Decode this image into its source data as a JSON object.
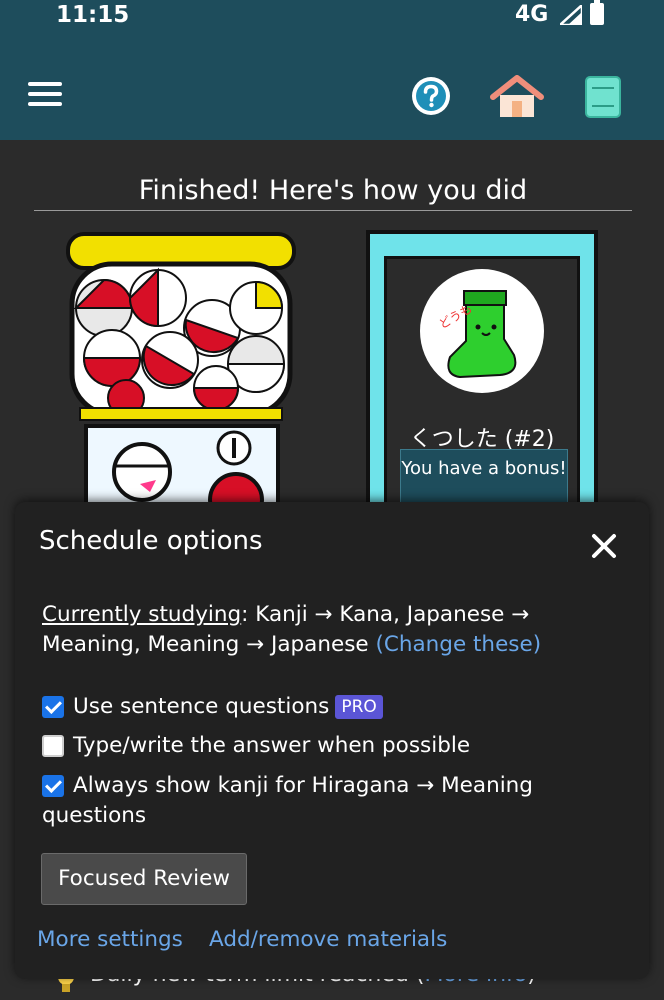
{
  "status_bar": {
    "time": "11:15",
    "network": "4G"
  },
  "colors": {
    "app_bar": "#1e4d5c",
    "accent_link": "#6aa6e8",
    "pro_badge": "#5b55d6",
    "checkbox_on": "#1a73e8",
    "card_border": "#6fe3ea"
  },
  "app_bar": {
    "icons": [
      "menu-icon",
      "help-icon",
      "home-icon",
      "book-icon"
    ]
  },
  "results": {
    "title": "Finished! Here's how you did",
    "card": {
      "name": "くつした (#2)",
      "bonus": "You have a bonus!",
      "image_text": "どうも"
    }
  },
  "bottom_notice": {
    "text": "Daily new term limit reached (",
    "link": "More info",
    "close": ")"
  },
  "schedule_sheet": {
    "title": "Schedule options",
    "studying_label": "Currently studying",
    "studying_value": ": Kanji → Kana, Japanese → Meaning, Meaning → Japanese ",
    "change_link": "(Change these)",
    "options": [
      {
        "label": "Use sentence questions",
        "badge": "PRO",
        "checked": true
      },
      {
        "label": "Type/write the answer when possible",
        "checked": false
      },
      {
        "label": "Always show kanji for Hiragana → Meaning",
        "label_line2": "questions",
        "checked": true
      }
    ],
    "focused_review_button": "Focused Review",
    "more_settings_link": "More settings",
    "add_remove_link": "Add/remove materials"
  }
}
